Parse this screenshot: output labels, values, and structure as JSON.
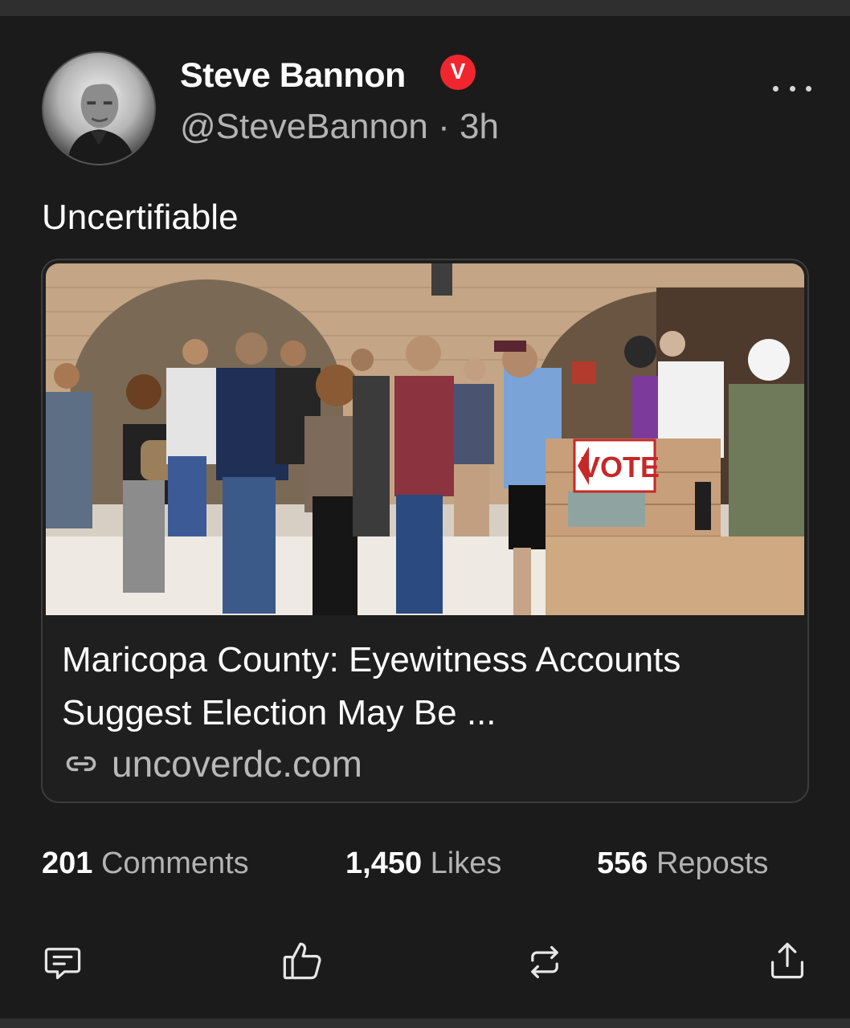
{
  "author": {
    "name": "Steve Bannon",
    "verified_badge": "V",
    "handle": "@SteveBannon",
    "separator": "·",
    "time": "3h",
    "avatar_icon": "profile-photo"
  },
  "post": {
    "text": "Uncertifiable"
  },
  "link_card": {
    "image_sign_text": "VOTE",
    "title": "Maricopa County: Eyewitness Accounts Suggest Election May Be ...",
    "domain": "uncoverdc.com",
    "link_icon": "link-icon"
  },
  "stats": {
    "comments": {
      "count": "201",
      "label": "Comments"
    },
    "likes": {
      "count": "1,450",
      "label": "Likes"
    },
    "reposts": {
      "count": "556",
      "label": "Reposts"
    }
  },
  "actions": {
    "comment_icon": "comment-icon",
    "like_icon": "thumbs-up-icon",
    "repost_icon": "repost-icon",
    "share_icon": "share-icon",
    "more_icon": "more-dots-icon"
  },
  "colors": {
    "background": "#1b1b1b",
    "verified": "#f0262f",
    "secondary_text": "#b3b3b3"
  }
}
